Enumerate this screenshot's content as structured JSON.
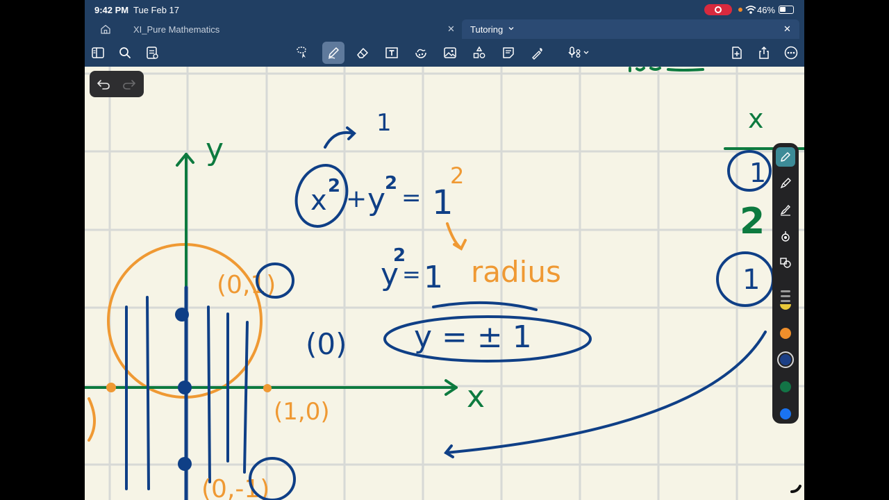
{
  "status": {
    "time": "9:42 PM",
    "date": "Tue Feb 17",
    "battery": "46%"
  },
  "tabs": [
    {
      "label": "XI_Pure Mathematics"
    },
    {
      "label": "Tutoring"
    }
  ],
  "colors": {
    "chrome": "#213f63",
    "paper": "#f6f4e6",
    "grid": "#d7d9d6",
    "ink_blue": "#0f3f86",
    "ink_orange": "#ef9933",
    "ink_green": "#0d7a3f"
  },
  "toolbar_icons": [
    "thumbnails-icon",
    "search-icon",
    "outline-icon",
    "lasso-icon",
    "pen-icon",
    "eraser-icon",
    "textbox-icon",
    "shapes-icon",
    "image-icon",
    "elements-icon",
    "sticky-note-icon",
    "laser-pointer-icon",
    "audio-record-icon",
    "add-page-icon",
    "share-icon",
    "more-icon"
  ],
  "palette": {
    "tools": [
      "fountain-pen-icon",
      "ball-pen-icon",
      "brush-pen-icon",
      "highlighter-icon",
      "shape-tool-icon"
    ],
    "swatches": [
      "#e9c93a",
      "#ef8f2b",
      "#1b3f86",
      "#137446",
      "#1a73f0"
    ],
    "selected_swatch": 2
  },
  "handwriting": {
    "equation": [
      "x",
      "2",
      "+",
      "y",
      "2",
      "=",
      "1",
      "2"
    ],
    "note_1": "1",
    "y_sq": [
      "y",
      "2",
      "=",
      "1"
    ],
    "radius": "radius",
    "zero_label": "(0)",
    "result": "y = ± 1",
    "axis_y": "y",
    "axis_x": "x",
    "point_top": "(0,1)",
    "point_right": "(1,0)",
    "point_bottom": "(0,-1)",
    "right_x": "x",
    "right_1a": "1",
    "right_2": "2",
    "right_1b": "1"
  }
}
